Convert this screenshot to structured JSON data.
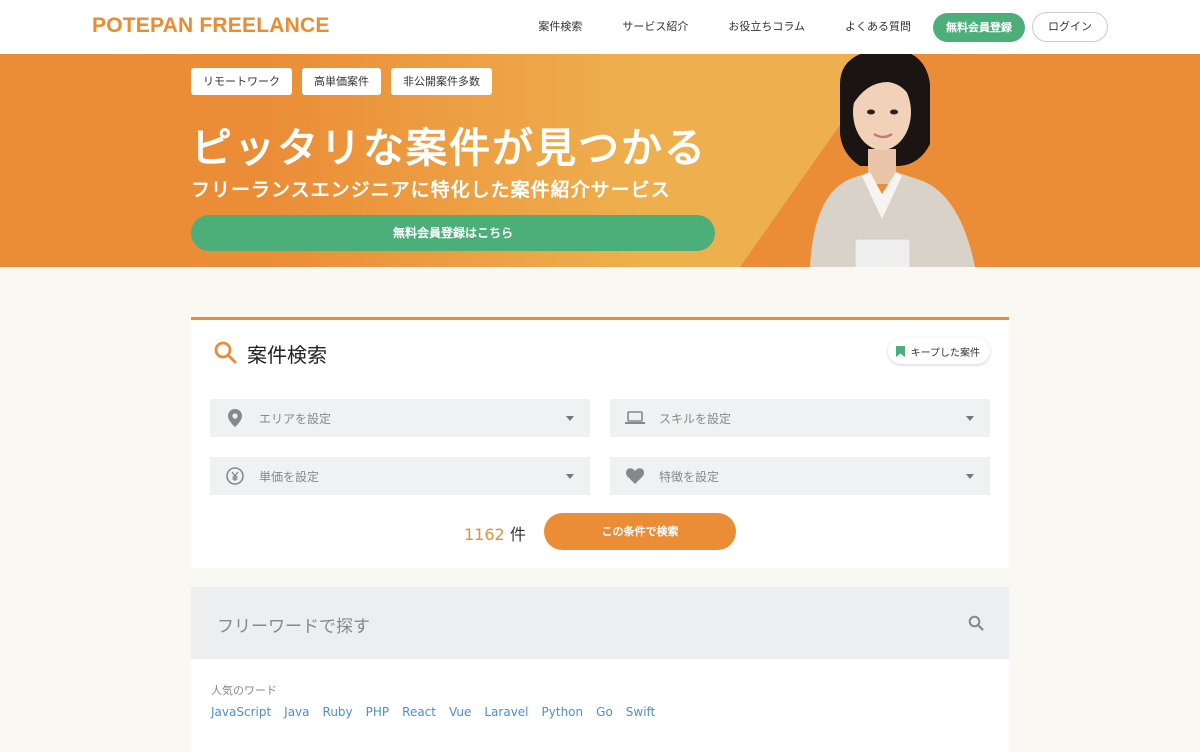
{
  "header": {
    "logo": "POTEPAN FREELANCE",
    "nav": [
      "案件検索",
      "サービス紹介",
      "お役立ちコラム",
      "よくある質問"
    ],
    "register_label": "無料会員登録",
    "login_label": "ログイン"
  },
  "hero": {
    "tags": [
      "リモートワーク",
      "高単価案件",
      "非公開案件多数"
    ],
    "title": "ピッタリな案件が見つかる",
    "subtitle": "フリーランスエンジニアに特化した案件紹介サービス",
    "cta_label": "無料会員登録はこちら"
  },
  "search": {
    "title": "案件検索",
    "keep_label": "キープした案件",
    "fields": {
      "area": "エリアを設定",
      "skill": "スキルを設定",
      "price": "単価を設定",
      "feature": "特徴を設定"
    },
    "count": "1162",
    "count_unit": "件",
    "submit_label": "この条件で検索"
  },
  "freeword": {
    "placeholder": "フリーワードで探す"
  },
  "popular": {
    "label": "人気のワード",
    "words": [
      "JavaScript",
      "Java",
      "Ruby",
      "PHP",
      "React",
      "Vue",
      "Laravel",
      "Python",
      "Go",
      "Swift"
    ]
  },
  "colors": {
    "accent": "#eb8c37",
    "green": "#4caf7a",
    "link": "#4a8fd6"
  }
}
